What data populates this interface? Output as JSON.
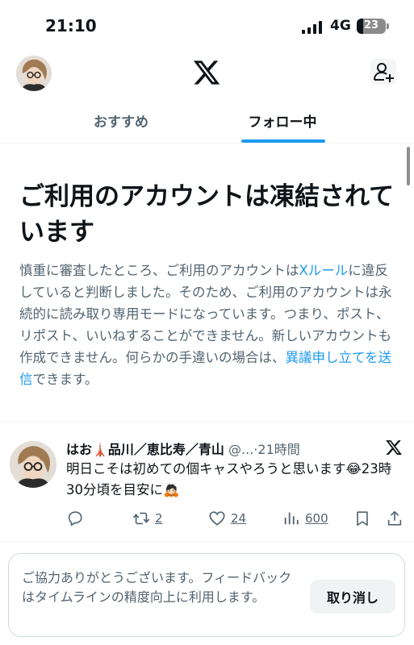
{
  "status_bar": {
    "time": "21:10",
    "network": "4G",
    "battery": "23",
    "battery_level": 0.23
  },
  "header": {
    "logo_icon": "x-logo-icon",
    "add_person_icon": "add-person-icon"
  },
  "tabs": {
    "recommended": "おすすめ",
    "following": "フォロー中",
    "active": "following"
  },
  "notice": {
    "title": "ご利用のアカウントは凍結されています",
    "body_1": "慎重に審査したところ、ご利用のアカウントは",
    "rules_link": "Xルール",
    "body_2": "に違反していると判断しました。そのため、ご利用のアカウントは永続的に読み取り専用モードになっています。つまり、ポスト、リポスト、いいねすることができません。新しいアカウントも作成できません。何らかの手違いの場合は、",
    "appeal_link": "異議申し立てを送信",
    "body_3": "できます。"
  },
  "tweet": {
    "name": "はお🗼品川／恵比寿／青山",
    "handle": "@...",
    "separator": "·",
    "time": "21時間",
    "text": "明日こそは初めての個キャスやろうと思います😂23時30分頃を目安に🙇🏻",
    "reply_icon": "reply-icon",
    "retweet_count": "2",
    "like_count": "24",
    "view_count": "600",
    "bookmark_icon": "bookmark-icon",
    "share_icon": "share-icon"
  },
  "feedback": {
    "text": "ご協力ありがとうございます。フィードバックはタイムラインの精度向上に利用します。",
    "undo_label": "取り消し"
  },
  "colors": {
    "accent": "#1d9bf0",
    "text_primary": "#0f1419",
    "text_secondary": "#536471",
    "border": "#eff3f4"
  }
}
